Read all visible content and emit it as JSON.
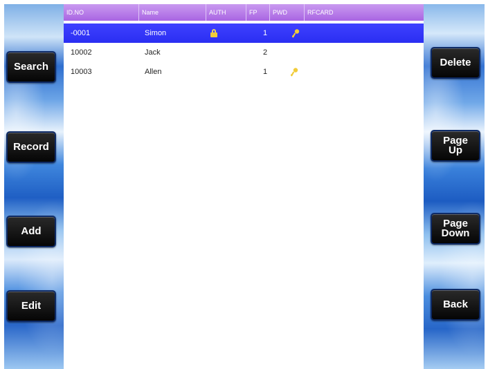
{
  "left_buttons": [
    "Search",
    "Record",
    "Add",
    "Edit"
  ],
  "right_buttons": [
    {
      "line1": "Delete",
      "line2": ""
    },
    {
      "line1": "Page",
      "line2": "Up"
    },
    {
      "line1": "Page",
      "line2": "Down"
    },
    {
      "line1": "Back",
      "line2": ""
    }
  ],
  "table": {
    "headers": [
      "ID.NO",
      "Name",
      "AUTH",
      "FP",
      "PWD",
      "RFCARD"
    ],
    "rows": [
      {
        "id": "-0001",
        "name": "Simon",
        "auth_icon": "lock-icon",
        "fp": "1",
        "pwd_icon": "key-icon",
        "rfcard": "",
        "selected": true
      },
      {
        "id": "10002",
        "name": "Jack",
        "auth_icon": "",
        "fp": "2",
        "pwd_icon": "",
        "rfcard": "",
        "selected": false
      },
      {
        "id": "10003",
        "name": "Allen",
        "auth_icon": "",
        "fp": "1",
        "pwd_icon": "key-icon",
        "rfcard": "",
        "selected": false
      }
    ]
  },
  "colors": {
    "header": "#b57bea",
    "selected_row": "#3537fa",
    "button": "#111111",
    "icon_gold": "#f1cc3a"
  }
}
